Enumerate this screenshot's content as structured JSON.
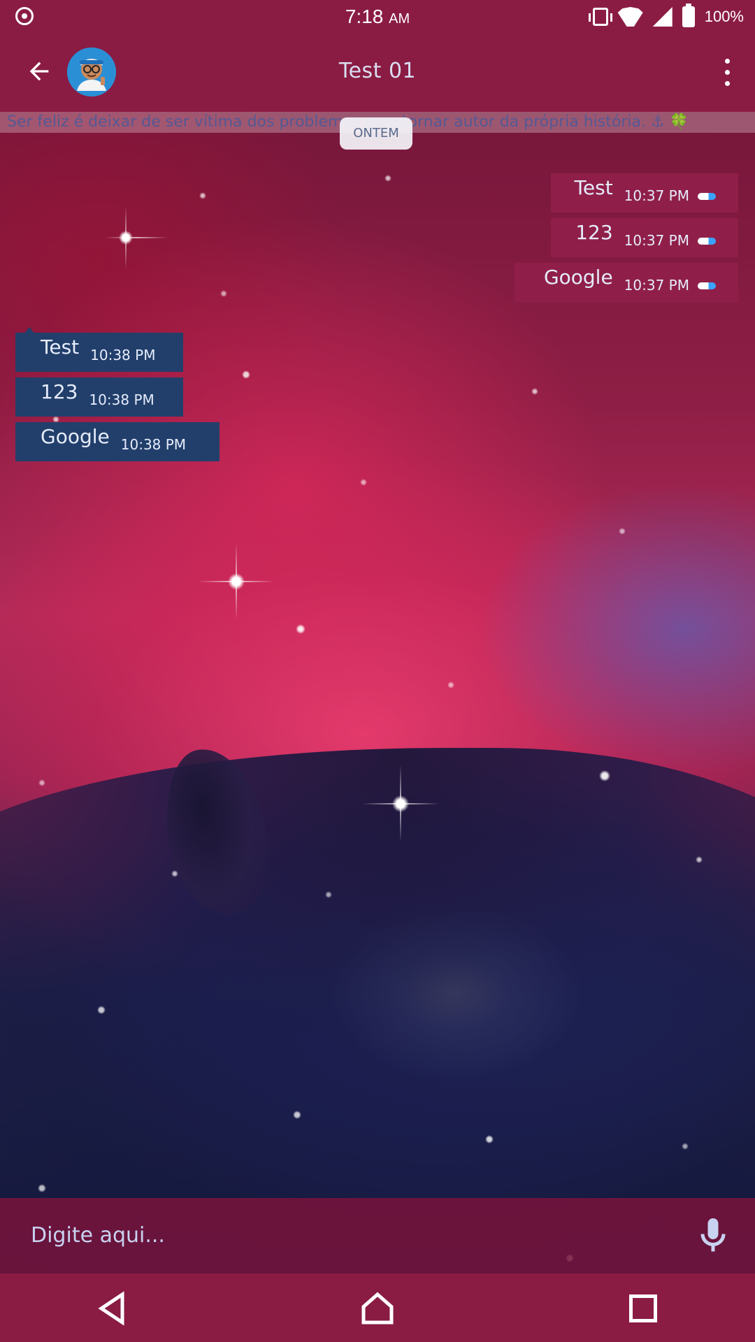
{
  "status_bar": {
    "time": "7:18",
    "am_pm": "AM",
    "battery": "100%",
    "icons": [
      "notification-target-icon",
      "vibrate-icon",
      "wifi-icon",
      "signal-icon",
      "battery-charging-icon"
    ]
  },
  "app_bar": {
    "title": "Test 01",
    "back_icon": "arrow-left-icon",
    "menu_icon": "more-vertical-icon",
    "avatar": "contact-avatar"
  },
  "status_line": {
    "text": "Ser feliz é deixar de ser vítima dos problemas e se tornar autor da própria história. ⚓ 🍀"
  },
  "date_chip": {
    "label": "ONTEM"
  },
  "messages": {
    "outgoing": [
      {
        "text": "Test",
        "time": "10:37 PM"
      },
      {
        "text": "123",
        "time": "10:37 PM"
      },
      {
        "text": "Google",
        "time": "10:37 PM"
      }
    ],
    "incoming": [
      {
        "text": "Test",
        "time": "10:38 PM"
      },
      {
        "text": "123",
        "time": "10:38 PM"
      },
      {
        "text": "Google",
        "time": "10:38 PM"
      }
    ]
  },
  "input": {
    "placeholder": "Digite aqui...",
    "mic_icon": "microphone-icon"
  },
  "nav_bar": {
    "icons": [
      "back-triangle-icon",
      "home-icon",
      "recents-square-icon"
    ]
  },
  "colors": {
    "primary": "#8a1c43",
    "outgoing_bubble": "#8f1f49",
    "incoming_bubble": "#223f6b",
    "accent_blue": "#3aa2ff"
  }
}
